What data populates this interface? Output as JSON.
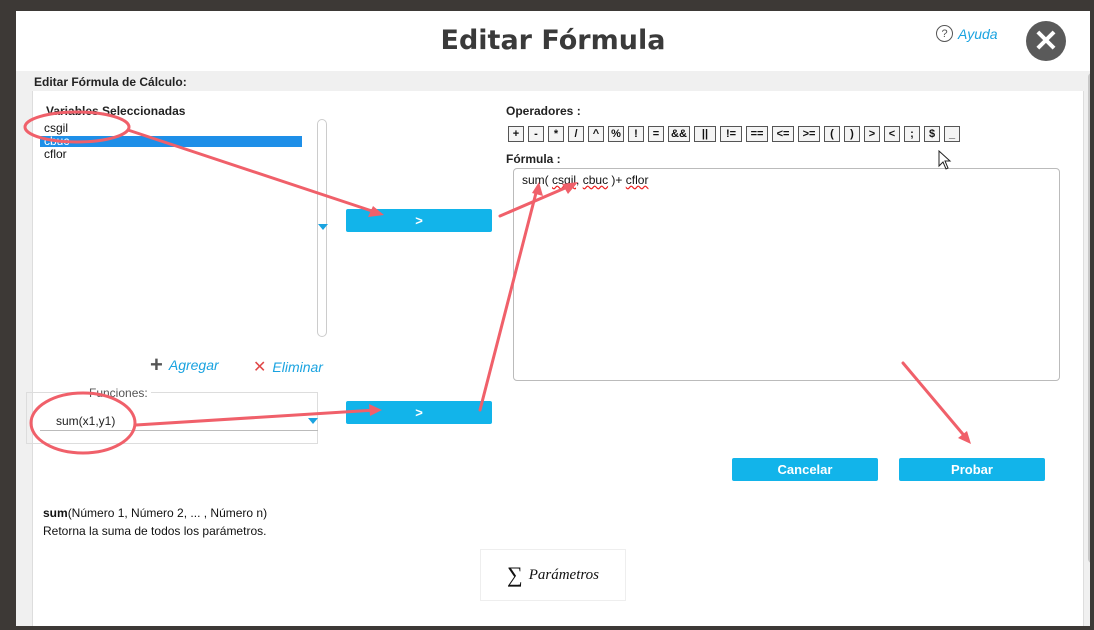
{
  "modal": {
    "title": "Editar Fórmula",
    "help_label": "Ayuda",
    "section_label": "Editar Fórmula de Cálculo:"
  },
  "variables": {
    "header": "Variables Seleccionadas",
    "items": [
      "csgil",
      "cbuc",
      "cflor"
    ],
    "selected": "cbuc"
  },
  "actions": {
    "insert_variable_label": ">",
    "insert_function_label": ">",
    "add_label": "Agregar",
    "remove_label": "Eliminar"
  },
  "functions": {
    "legend": "Funciones:",
    "selected": "sum(x1,y1)"
  },
  "operators": {
    "label": "Operadores :",
    "items": [
      "+",
      "-",
      "*",
      "/",
      "^",
      "%",
      "!",
      "=",
      "&&",
      "||",
      "!=",
      "==",
      "<=",
      ">=",
      "(",
      ")",
      ">",
      "<",
      ";",
      "$",
      "_"
    ]
  },
  "formula": {
    "label": "Fórmula :",
    "text_prefix": "sum(",
    "var1": "csgil",
    "sep": ",",
    "var2": "cbuc",
    "mid": ")+",
    "var3": "cflor"
  },
  "buttons": {
    "cancel": "Cancelar",
    "test": "Probar"
  },
  "description": {
    "func_name": "sum",
    "signature": "(Número 1, Número 2, ... , Número n)",
    "text": "Retorna la suma de todos los parámetros."
  },
  "params_panel": {
    "label": "Parámetros"
  },
  "colors": {
    "accent": "#12b4ea",
    "selection": "#1e8fe8",
    "annotation": "#f0606a"
  }
}
